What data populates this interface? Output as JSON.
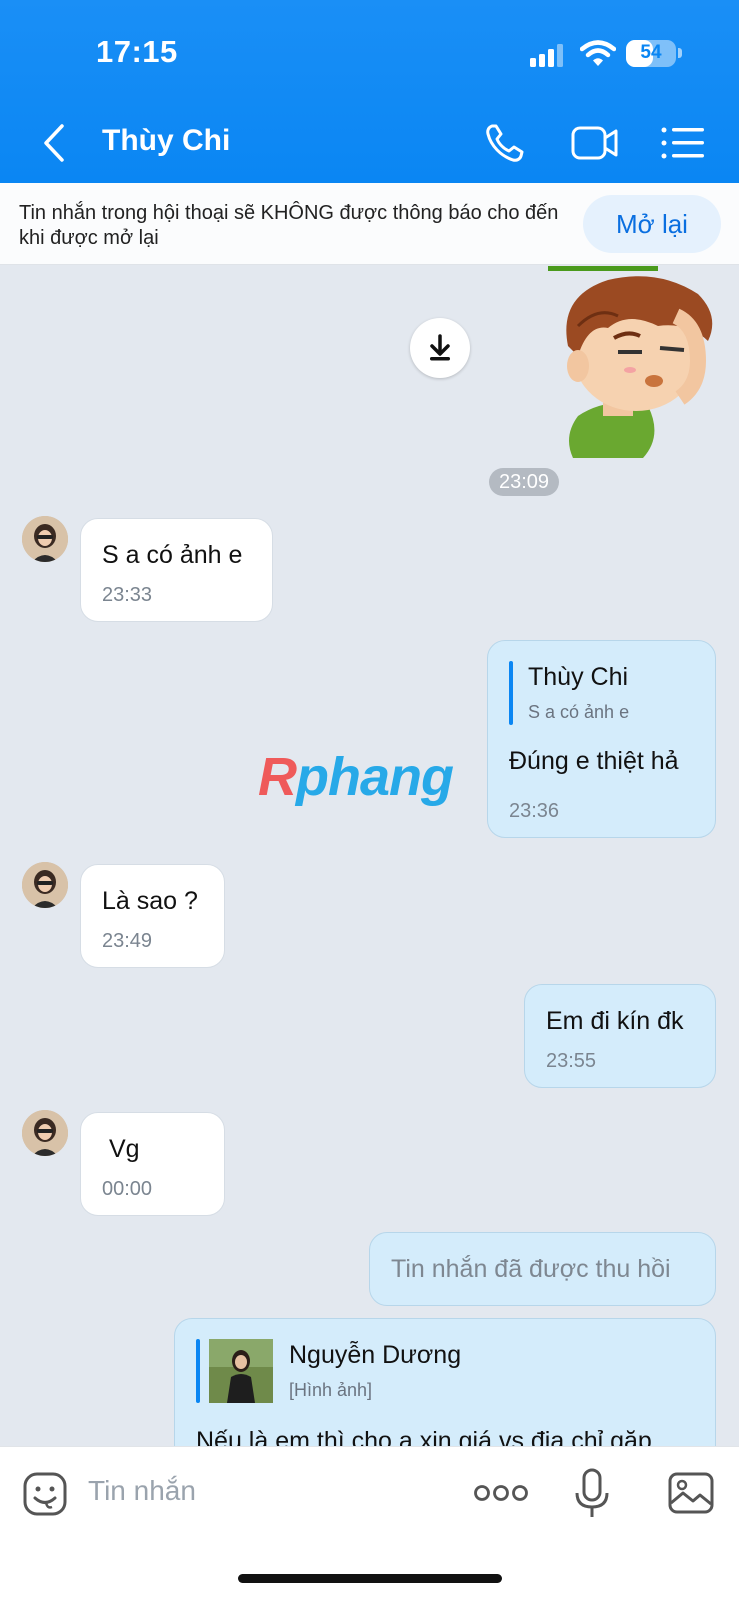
{
  "status": {
    "time": "17:15",
    "battery": "54",
    "battery_level": 0.54
  },
  "header": {
    "contact_name": "Thùy Chi"
  },
  "notice": {
    "text": "Tin nhắn trong hội thoại sẽ KHÔNG được thông báo cho đến khi được mở lại",
    "button": "Mở lại"
  },
  "chat": {
    "time_chip": "23:09",
    "messages": [
      {
        "text": "S a có ảnh e",
        "time": "23:33"
      },
      {
        "quote_name": "Thùy Chi",
        "quote_text": "S a có ảnh e",
        "text": "Đúng e thiệt hả",
        "time": "23:36"
      },
      {
        "text": "Là sao ?",
        "time": "23:49"
      },
      {
        "text": "Em đi kín đk",
        "time": "23:55"
      },
      {
        "text": "Vg",
        "time": "00:00"
      },
      {
        "text": "Tin nhắn đã được thu hồi"
      },
      {
        "quote_name": "Nguyễn Dương",
        "quote_text": "[Hình ảnh]",
        "text": "Nếu là em thì cho a xin giá vs địa chỉ gặp"
      }
    ]
  },
  "watermark": {
    "first": "R",
    "rest": "phang"
  },
  "composer": {
    "placeholder": "Tin nhắn"
  },
  "colors": {
    "header": "#0a86f3",
    "incoming": "#ffffff",
    "outgoing": "#d4ecfb",
    "background": "#e3e8ef"
  }
}
